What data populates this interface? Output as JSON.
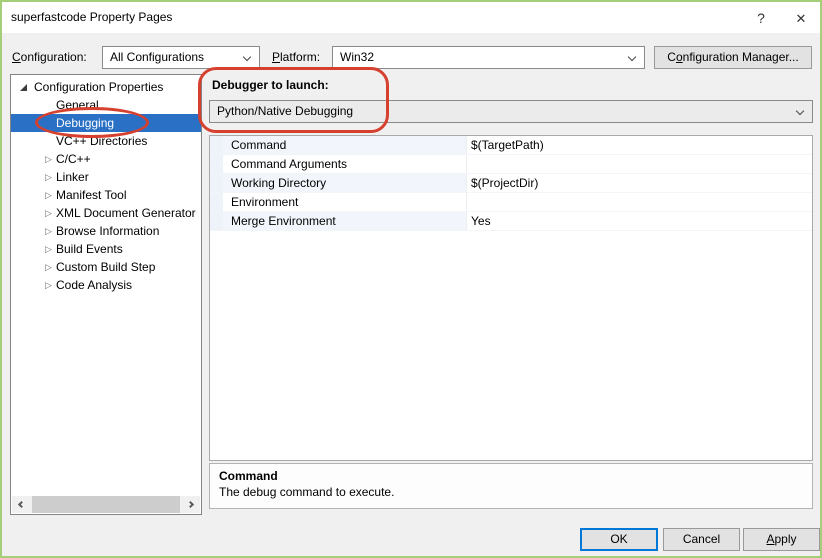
{
  "window": {
    "title": "superfastcode Property Pages",
    "help_glyph": "?",
    "close_glyph": "✕"
  },
  "toolbar": {
    "configuration_label": {
      "key": "C",
      "rest": "onfiguration:"
    },
    "configuration_value": "All Configurations",
    "platform_label": {
      "key": "P",
      "rest": "latform:"
    },
    "platform_value": "Win32",
    "config_manager_label": {
      "pre": "C",
      "key": "o",
      "rest": "nfiguration Manager..."
    }
  },
  "tree": {
    "root": "Configuration Properties",
    "collapsed_glyph": "▷",
    "items": [
      {
        "label": "General",
        "expandable": false,
        "selected": false
      },
      {
        "label": "Debugging",
        "expandable": false,
        "selected": true
      },
      {
        "label": "VC++ Directories",
        "expandable": false,
        "selected": false
      },
      {
        "label": "C/C++",
        "expandable": true,
        "selected": false
      },
      {
        "label": "Linker",
        "expandable": true,
        "selected": false
      },
      {
        "label": "Manifest Tool",
        "expandable": true,
        "selected": false
      },
      {
        "label": "XML Document Generator",
        "expandable": true,
        "selected": false
      },
      {
        "label": "Browse Information",
        "expandable": true,
        "selected": false
      },
      {
        "label": "Build Events",
        "expandable": true,
        "selected": false
      },
      {
        "label": "Custom Build Step",
        "expandable": true,
        "selected": false
      },
      {
        "label": "Code Analysis",
        "expandable": true,
        "selected": false
      }
    ]
  },
  "debugger": {
    "label": "Debugger to launch:",
    "value": "Python/Native Debugging"
  },
  "properties": {
    "rows": [
      {
        "name": "Command",
        "value": "$(TargetPath)"
      },
      {
        "name": "Command Arguments",
        "value": ""
      },
      {
        "name": "Working Directory",
        "value": "$(ProjectDir)"
      },
      {
        "name": "Environment",
        "value": ""
      },
      {
        "name": "Merge Environment",
        "value": "Yes"
      }
    ]
  },
  "description": {
    "title": "Command",
    "text": "The debug command to execute."
  },
  "buttons": {
    "ok": "OK",
    "cancel": "Cancel",
    "apply": {
      "key": "A",
      "rest": "pply"
    }
  },
  "colors": {
    "frame_border": "#a6cd77",
    "selection_blue": "#2a70c5",
    "annotation_red": "#d6402f",
    "default_button_border": "#0078d7",
    "dialog_background": "#f0f0f0"
  }
}
